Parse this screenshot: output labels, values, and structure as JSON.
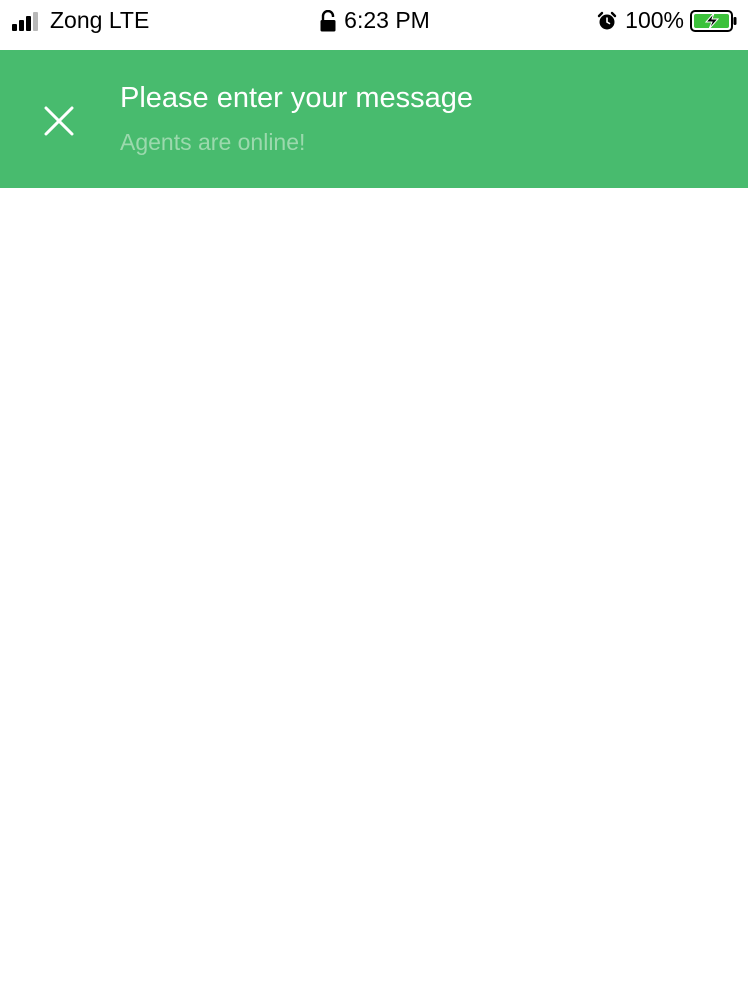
{
  "status_bar": {
    "carrier": "Zong LTE",
    "time": "6:23 PM",
    "battery": "100%",
    "icons": [
      "signal-icon",
      "lock-icon",
      "alarm-icon",
      "battery-icon"
    ]
  },
  "header": {
    "title": "Please enter your message",
    "subtitle": "Agents are online!",
    "close_icon": "close-icon",
    "background_color": "#48bb6e"
  }
}
